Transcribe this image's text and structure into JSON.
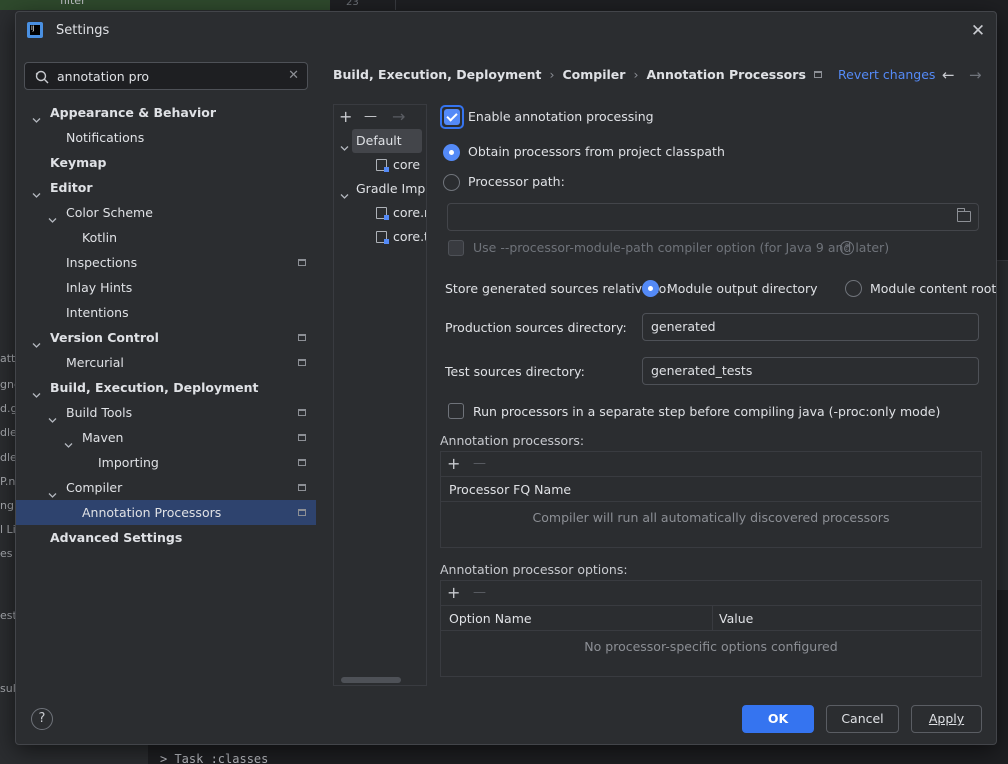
{
  "background": {
    "filter_label": "filter",
    "line_number": "23",
    "left_fragments": [
      "attr",
      "gne",
      "d.g",
      "dlev",
      "dlev",
      "P.n",
      "ng",
      "l Li",
      "es",
      "ests",
      "sult"
    ],
    "console_line": "> Task :classes"
  },
  "dialog": {
    "title": "Settings",
    "close_icon": "close-icon"
  },
  "search": {
    "value": "annotation pro",
    "placeholder": ""
  },
  "tree": [
    {
      "label": "Appearance & Behavior",
      "bold": true,
      "expanded": true,
      "level": 0,
      "badge": false
    },
    {
      "label": "Notifications",
      "bold": false,
      "level": 1,
      "badge": false
    },
    {
      "label": "Keymap",
      "bold": true,
      "level": 0,
      "badge": false
    },
    {
      "label": "Editor",
      "bold": true,
      "expanded": true,
      "level": 0,
      "badge": false
    },
    {
      "label": "Color Scheme",
      "bold": false,
      "expanded": true,
      "level": 1,
      "badge": false
    },
    {
      "label": "Kotlin",
      "bold": false,
      "level": 2,
      "badge": false
    },
    {
      "label": "Inspections",
      "bold": false,
      "level": 1,
      "badge": true
    },
    {
      "label": "Inlay Hints",
      "bold": false,
      "level": 1,
      "badge": false
    },
    {
      "label": "Intentions",
      "bold": false,
      "level": 1,
      "badge": false
    },
    {
      "label": "Version Control",
      "bold": true,
      "expanded": true,
      "level": 0,
      "badge": true
    },
    {
      "label": "Mercurial",
      "bold": false,
      "level": 1,
      "badge": true
    },
    {
      "label": "Build, Execution, Deployment",
      "bold": true,
      "expanded": true,
      "level": 0,
      "badge": false
    },
    {
      "label": "Build Tools",
      "bold": false,
      "expanded": true,
      "level": 1,
      "badge": true
    },
    {
      "label": "Maven",
      "bold": false,
      "expanded": true,
      "level": 2,
      "badge": true
    },
    {
      "label": "Importing",
      "bold": false,
      "level": 3,
      "badge": true
    },
    {
      "label": "Compiler",
      "bold": false,
      "expanded": true,
      "level": 1,
      "badge": true
    },
    {
      "label": "Annotation Processors",
      "bold": false,
      "level": 2,
      "badge": true,
      "selected": true
    },
    {
      "label": "Advanced Settings",
      "bold": true,
      "level": 0,
      "badge": false
    }
  ],
  "breadcrumb": [
    "Build, Execution, Deployment",
    "Compiler",
    "Annotation Processors"
  ],
  "breadcrumb_sep": "›",
  "header": {
    "revert": "Revert changes",
    "back_arrow": "←",
    "forward_arrow": "→"
  },
  "profiles": {
    "add": "+",
    "remove": "—",
    "move": "→",
    "items": [
      {
        "label": "Default",
        "type": "group",
        "expanded": true
      },
      {
        "label": "core",
        "type": "module"
      },
      {
        "label": "Gradle Imported",
        "type": "group",
        "expanded": true
      },
      {
        "label": "core.main",
        "type": "module"
      },
      {
        "label": "core.test",
        "type": "module"
      }
    ]
  },
  "form": {
    "enable_label": "Enable annotation processing",
    "enable_checked": true,
    "obtain_label": "Obtain processors from project classpath",
    "obtain_selected": true,
    "processor_path_label": "Processor path:",
    "processor_path_value": "",
    "module_path_label": "Use --processor-module-path compiler option (for Java 9 and later)",
    "help_glyph": "?",
    "store_label": "Store generated sources relative to:",
    "store_option_1": "Module output directory",
    "store_option_2": "Module content root",
    "store_selected": "Module output directory",
    "production_label": "Production sources directory:",
    "production_value": "generated",
    "test_label": "Test sources directory:",
    "test_value": "generated_tests",
    "separate_step_label": "Run processors in a separate step before compiling java (-proc:only mode)",
    "separate_step_checked": false
  },
  "processors_table": {
    "title": "Annotation processors:",
    "add": "+",
    "remove": "—",
    "column": "Processor FQ Name",
    "empty_text": "Compiler will run all automatically discovered processors"
  },
  "options_table": {
    "title": "Annotation processor options:",
    "add": "+",
    "remove": "—",
    "columns": [
      "Option Name",
      "Value"
    ],
    "empty_text": "No processor-specific options configured"
  },
  "footer": {
    "help": "?",
    "ok": "OK",
    "cancel": "Cancel",
    "apply": "Apply"
  },
  "colors": {
    "accent": "#3574f0",
    "link": "#548af7",
    "selection": "#2e436e",
    "dialog_bg": "#2b2d30"
  }
}
